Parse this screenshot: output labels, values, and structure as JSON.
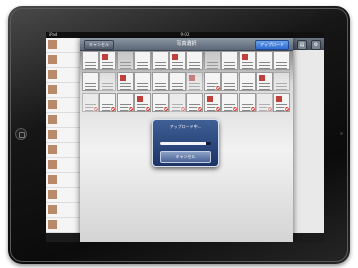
{
  "statusbar": {
    "carrier": "iPad",
    "time": "9:02",
    "battery": ""
  },
  "picker": {
    "back_label": "キャンセル",
    "title": "写真選択",
    "upload_label": "アップロード",
    "thumb_rows": [
      [
        false,
        false,
        false,
        false,
        false,
        false,
        false,
        false,
        false,
        false,
        false,
        false
      ],
      [
        false,
        false,
        false,
        false,
        false,
        false,
        false,
        true,
        false,
        false,
        false,
        false
      ],
      [
        true,
        true,
        true,
        true,
        true,
        true,
        true,
        true,
        true,
        true,
        true,
        true
      ]
    ]
  },
  "right_tools": {
    "icon1": "pages-icon",
    "icon2": "settings-icon"
  },
  "dialog": {
    "title": "アップロード中...",
    "progress": 0.9,
    "cancel_label": "キャンセル"
  },
  "colors": {
    "dialog": "#2a4a82",
    "badge": "#d42a22",
    "nav_upload": "#2e6bd2"
  }
}
